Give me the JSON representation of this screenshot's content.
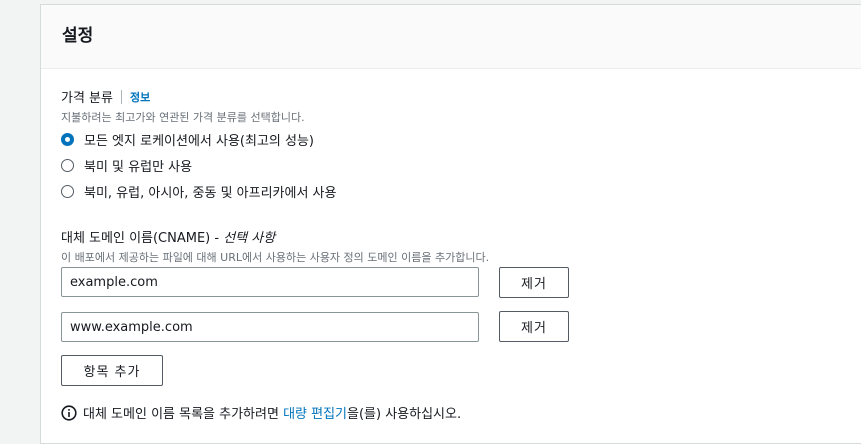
{
  "panel": {
    "title": "설정"
  },
  "price_class": {
    "label": "가격 분류",
    "info_link": "정보",
    "description": "지불하려는 최고가와 연관된 가격 분류를 선택합니다.",
    "options": [
      {
        "label": "모든 엣지 로케이션에서 사용(최고의 성능)",
        "checked": true
      },
      {
        "label": "북미 및 유럽만 사용",
        "checked": false
      },
      {
        "label": "북미, 유럽, 아시아, 중동 및 아프리카에서 사용",
        "checked": false
      }
    ]
  },
  "cname": {
    "label_main": "대체 도메인 이름(CNAME) - ",
    "label_optional": "선택 사항",
    "description": "이 배포에서 제공하는 파일에 대해 URL에서 사용하는 사용자 정의 도메인 이름을 추가합니다.",
    "items": [
      {
        "value": "example.com",
        "remove_label": "제거"
      },
      {
        "value": "www.example.com",
        "remove_label": "제거"
      }
    ],
    "add_label": "항목 추가",
    "footer": {
      "prefix": "대체 도메인 이름 목록을 추가하려면 ",
      "link": "대량 편집기",
      "suffix": "을(를) 사용하십시오."
    }
  },
  "colors": {
    "accent": "#0073bb",
    "text": "#16191f",
    "muted": "#687078"
  },
  "icons": {
    "info": "info-circle-icon"
  }
}
